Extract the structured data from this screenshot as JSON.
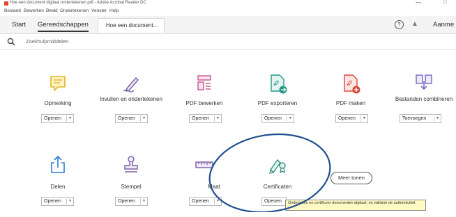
{
  "window": {
    "title": "Hoe een document digitaal ondertekenen.pdf - Adobe Acrobat Reader DC",
    "min_glyph": "—",
    "max_glyph": "□"
  },
  "menu": {
    "items": [
      "Bestand",
      "Bewerken",
      "Beeld",
      "Ondertekenen",
      "Venster",
      "Help"
    ]
  },
  "tabs": {
    "start": "Start",
    "tools": "Gereedschappen",
    "document": "Hoe een document...",
    "signin": "Aanme"
  },
  "search": {
    "placeholder": "Zoekhulpmiddelen"
  },
  "tools": [
    {
      "label": "Opmerking",
      "button": "Openen",
      "icon": "comment-icon",
      "color": "#e2b42a"
    },
    {
      "label": "Invullen en ondertekenen",
      "button": "Openen",
      "icon": "fill-sign-icon",
      "color": "#7b5ea7"
    },
    {
      "label": "PDF bewerken",
      "button": "Openen",
      "icon": "edit-pdf-icon",
      "color": "#c4568f"
    },
    {
      "label": "PDF exporteren",
      "button": "Openen",
      "icon": "export-pdf-icon",
      "color": "#22988a"
    },
    {
      "label": "PDF maken",
      "button": "Openen",
      "icon": "create-pdf-icon",
      "color": "#d9473a"
    },
    {
      "label": "Bestanden combineren",
      "button": "Toevoegen",
      "icon": "combine-files-icon",
      "color": "#6a5ec0"
    },
    {
      "label": "Delen",
      "button": "Openen",
      "icon": "share-icon",
      "color": "#2d7fd3"
    },
    {
      "label": "Stempel",
      "button": "Openen",
      "icon": "stamp-icon",
      "color": "#7b5ea7"
    },
    {
      "label": "Maat",
      "button": "Openen",
      "icon": "measure-icon",
      "color": "#7b5ea7"
    },
    {
      "label": "Certificaten",
      "button": "Openen",
      "icon": "certificates-icon",
      "color": "#2a8a7a"
    }
  ],
  "more_button": "Meer tonen",
  "tooltip": "Onderteken en certificeer documenten digitaal, en valideer de authenticiteit",
  "colors": {
    "annotation": "#1f4f8f",
    "tooltip_bg": "#fff9c4"
  }
}
